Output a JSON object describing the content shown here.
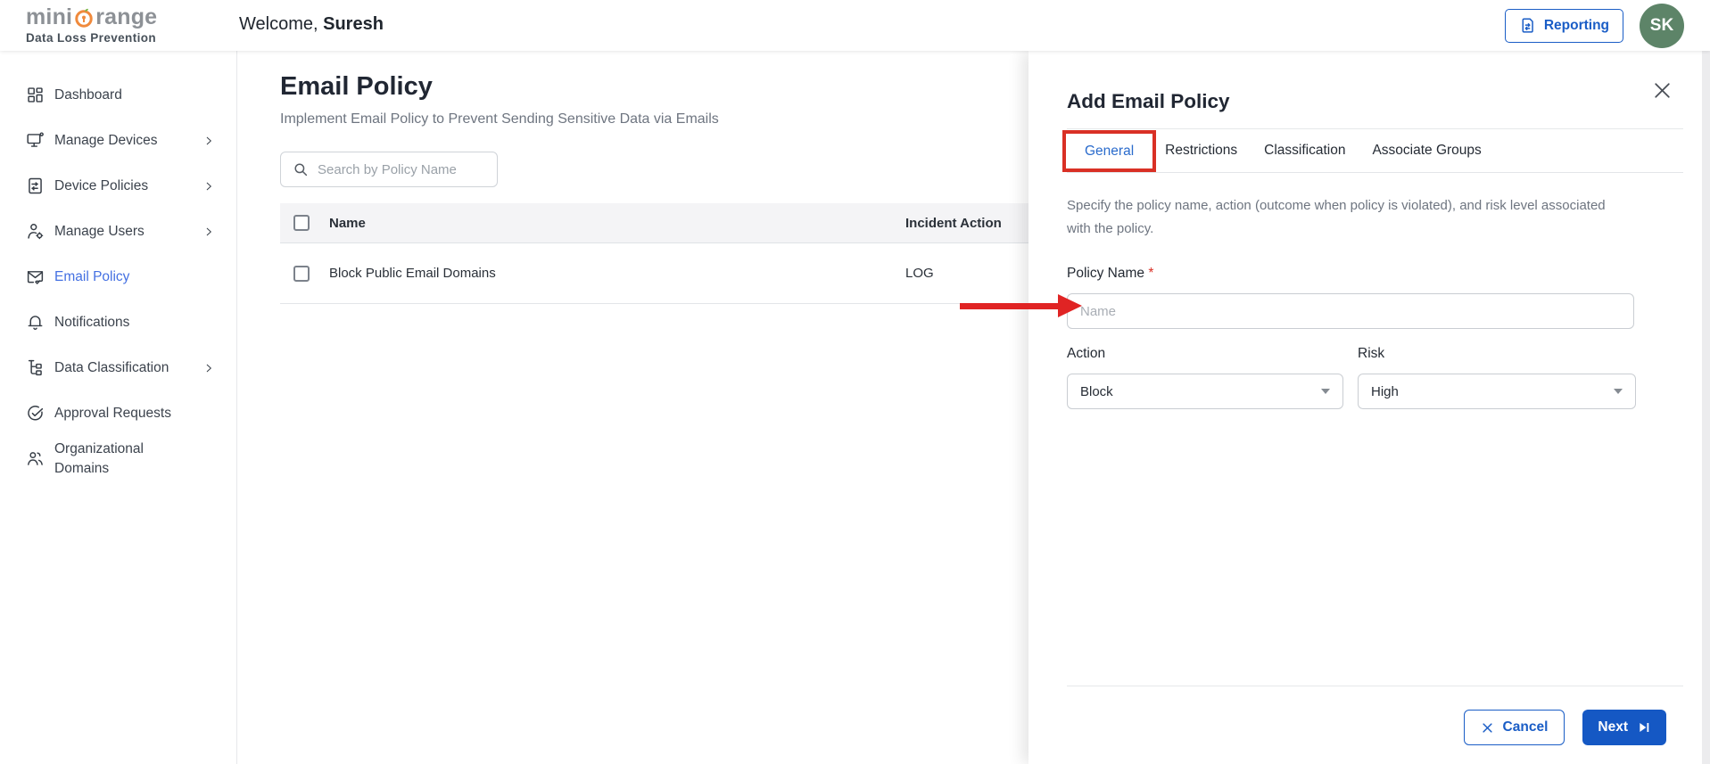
{
  "colors": {
    "primary_blue": "#1a5dc6",
    "next_button_bg": "#1558c4",
    "sidebar_active_blue": "#4470e2",
    "tab_active_blue": "#2a6bcc",
    "annotation_red": "#d93025",
    "arrow_red": "#e02424",
    "avatar_bg": "#5d8468",
    "logo_orange": "#f08a3c",
    "table_header_bg": "#f4f4f6"
  },
  "header": {
    "logo": {
      "brand_prefix": "mini",
      "brand_suffix": "range",
      "product": "Data Loss Prevention",
      "icon": "orange-lock-logo-icon"
    },
    "welcome_prefix": "Welcome, ",
    "welcome_name": "Suresh",
    "reporting_label": "Reporting",
    "reporting_icon": "report-document-icon",
    "avatar_initials": "SK"
  },
  "sidebar": {
    "items": [
      {
        "label": "Dashboard",
        "icon": "dashboard-icon",
        "expandable": false,
        "active": false
      },
      {
        "label": "Manage Devices",
        "icon": "monitor-icon",
        "expandable": true,
        "active": false
      },
      {
        "label": "Device Policies",
        "icon": "policy-document-icon",
        "expandable": true,
        "active": false
      },
      {
        "label": "Manage Users",
        "icon": "user-gear-icon",
        "expandable": true,
        "active": false
      },
      {
        "label": "Email Policy",
        "icon": "envelope-check-icon",
        "expandable": false,
        "active": true
      },
      {
        "label": "Notifications",
        "icon": "bell-icon",
        "expandable": false,
        "active": false
      },
      {
        "label": "Data Classification",
        "icon": "classification-tree-icon",
        "expandable": true,
        "active": false
      },
      {
        "label": "Approval Requests",
        "icon": "check-circle-icon",
        "expandable": false,
        "active": false
      },
      {
        "label": "Organizational Domains",
        "icon": "people-icon",
        "expandable": false,
        "active": false
      }
    ]
  },
  "main": {
    "title": "Email Policy",
    "subtitle": "Implement Email Policy to Prevent Sending Sensitive Data via Emails",
    "search_placeholder": "Search by Policy Name",
    "search_icon": "magnifier-icon",
    "table": {
      "columns": {
        "name": "Name",
        "incident_action": "Incident Action"
      },
      "rows": [
        {
          "name": "Block Public Email Domains",
          "incident_action": "LOG"
        }
      ]
    }
  },
  "drawer": {
    "title": "Add Email Policy",
    "close_icon": "close-x-icon",
    "tabs": [
      {
        "label": "General",
        "active": true,
        "annotated": true
      },
      {
        "label": "Restrictions",
        "active": false
      },
      {
        "label": "Classification",
        "active": false
      },
      {
        "label": "Associate Groups",
        "active": false
      }
    ],
    "description": "Specify the policy name, action (outcome when policy is violated), and risk level associated with the policy.",
    "fields": {
      "policy_name": {
        "label": "Policy Name",
        "required_marker": "*",
        "placeholder": "Name",
        "value": ""
      },
      "action": {
        "label": "Action",
        "value": "Block"
      },
      "risk": {
        "label": "Risk",
        "value": "High"
      }
    },
    "cancel_label": "Cancel",
    "next_label": "Next",
    "next_icon": "skip-next-icon",
    "cancel_icon": "x-icon"
  },
  "annotations": {
    "red_box_target": "General tab",
    "red_arrow_target": "Policy Name input"
  }
}
